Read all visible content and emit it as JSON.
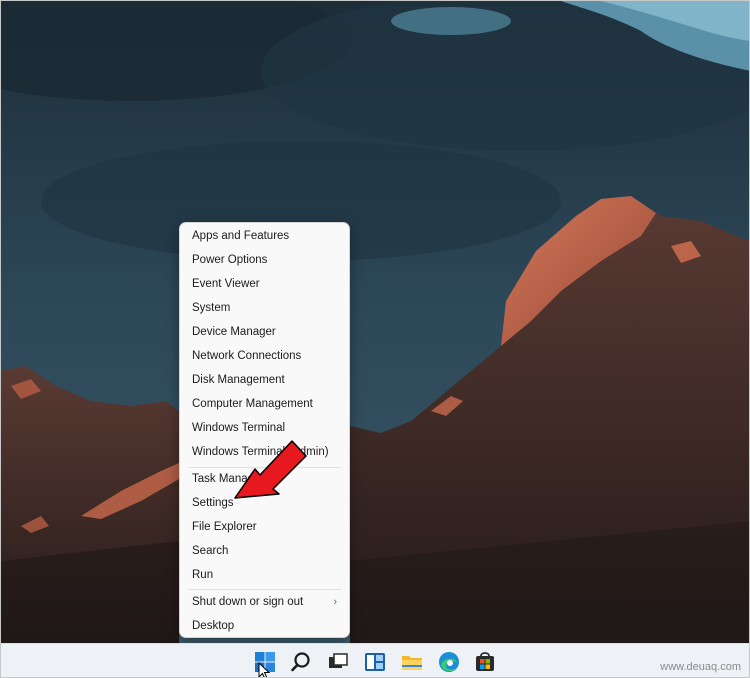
{
  "context_menu": {
    "items": [
      {
        "label": "Apps and Features"
      },
      {
        "label": "Power Options"
      },
      {
        "label": "Event Viewer"
      },
      {
        "label": "System"
      },
      {
        "label": "Device Manager"
      },
      {
        "label": "Network Connections"
      },
      {
        "label": "Disk Management"
      },
      {
        "label": "Computer Management"
      },
      {
        "label": "Windows Terminal"
      },
      {
        "label": "Windows Terminal (Admin)"
      },
      {
        "label": "Task Manager"
      },
      {
        "label": "Settings"
      },
      {
        "label": "File Explorer"
      },
      {
        "label": "Search"
      },
      {
        "label": "Run"
      },
      {
        "label": "Shut down or sign out"
      },
      {
        "label": "Desktop"
      }
    ],
    "submenu_chevron": "›"
  },
  "annotation": {
    "arrow_color": "#e8191e",
    "points_to": "Settings"
  },
  "taskbar": {
    "icons": [
      "start-icon",
      "search-icon",
      "task-view-icon",
      "widgets-icon",
      "file-explorer-icon",
      "edge-icon",
      "store-icon"
    ]
  },
  "watermark": "www.deuaq.com"
}
